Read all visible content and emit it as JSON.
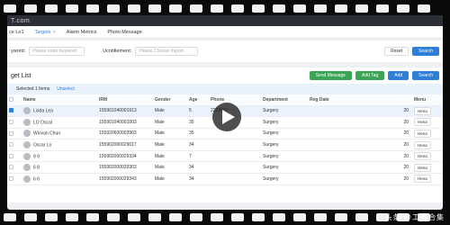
{
  "app": {
    "logo": "T.com"
  },
  "tabs": [
    {
      "label": "ce Lo1"
    },
    {
      "label": "Targets",
      "close": "×"
    },
    {
      "label": "Alarm Metrics"
    },
    {
      "label": "Photo Message"
    }
  ],
  "filter": {
    "keyword_label": "yword:",
    "keyword_placeholder": "Please enter Keyword",
    "identity_label": "Ucntitlement:",
    "identity_placeholder": "Please Choose Import",
    "reset": "Reset",
    "search": "Search"
  },
  "list": {
    "title": "get List",
    "buttons": {
      "send": "Send Message",
      "add": "Add Tag",
      "add2": "Add",
      "search": "Search"
    },
    "selection": {
      "text": "Selected 1 Items",
      "unselect": "Unselect"
    }
  },
  "table": {
    "columns": [
      "Name",
      "IRM",
      "Gender",
      "Age",
      "Phone",
      "Department",
      "Reg Date",
      "",
      "Menu"
    ],
    "rows": [
      {
        "name": "Loida Lea",
        "irm": "155901040001913",
        "gender": "Male",
        "age": "5",
        "phone": "2223417",
        "dept": "Surgery",
        "date": "20",
        "menu": "Hena",
        "selected": true
      },
      {
        "name": "LO Oscal",
        "irm": "155901040001003",
        "gender": "Male",
        "age": "35",
        "phone": "",
        "dept": "Surgery",
        "date": "20",
        "menu": "Hena",
        "selected": false
      },
      {
        "name": "Winvan Chun",
        "irm": "155920600003903",
        "gender": "Male",
        "age": "35",
        "phone": "",
        "dept": "Surgery",
        "date": "20",
        "menu": "Hena",
        "selected": false
      },
      {
        "name": "Oscar Lo",
        "irm": "155902000029017",
        "gender": "Male",
        "age": "34",
        "phone": "",
        "dept": "Surgery",
        "date": "20",
        "menu": "Hena",
        "selected": false
      },
      {
        "name": "9 9",
        "irm": "155902000029334",
        "gender": "Male",
        "age": "7",
        "phone": "",
        "dept": "Surgery",
        "date": "20",
        "menu": "Hena",
        "selected": false
      },
      {
        "name": "6 8",
        "irm": "155902000029303",
        "gender": "Male",
        "age": "34",
        "phone": "",
        "dept": "Surgery",
        "date": "20",
        "menu": "Hena",
        "selected": false
      },
      {
        "name": "6 6",
        "irm": "155902000029343",
        "gender": "Male",
        "age": "34",
        "phone": "",
        "dept": "Surgery",
        "date": "20",
        "menu": "Hena",
        "selected": false
      }
    ]
  },
  "watermark": "头条 @工具合集"
}
